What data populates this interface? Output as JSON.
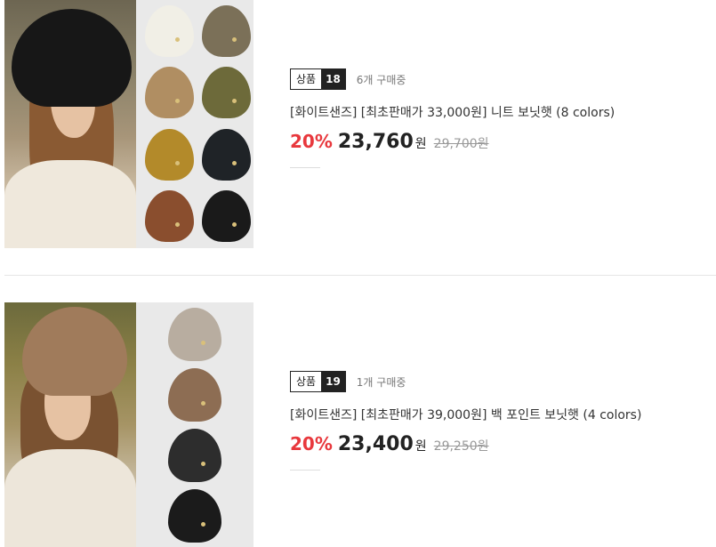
{
  "products": [
    {
      "badge_label": "상품",
      "badge_number": "18",
      "buyers": "6개 구매중",
      "title": "[화이트샌즈] [최초판매가 33,000원] 니트 보닛햇 (8 colors)",
      "discount": "20%",
      "sale_price": "23,760",
      "currency": "원",
      "original_price": "29,700원",
      "swatch_colors": [
        "#f1efe6",
        "#7b7058",
        "#b08e62",
        "#6d6a3a",
        "#b38a2a",
        "#1f2327",
        "#8a4e2e",
        "#1a1a1a"
      ]
    },
    {
      "badge_label": "상품",
      "badge_number": "19",
      "buyers": "1개 구매중",
      "title": "[화이트샌즈] [최초판매가 39,000원] 백 포인트 보닛햇 (4 colors)",
      "discount": "20%",
      "sale_price": "23,400",
      "currency": "원",
      "original_price": "29,250원",
      "swatch_colors": [
        "#b8ada0",
        "#8d6d53",
        "#2d2d2d",
        "#1b1b1b"
      ]
    }
  ],
  "colors": {
    "discount": "#e8383d",
    "badge_dark": "#222222"
  }
}
